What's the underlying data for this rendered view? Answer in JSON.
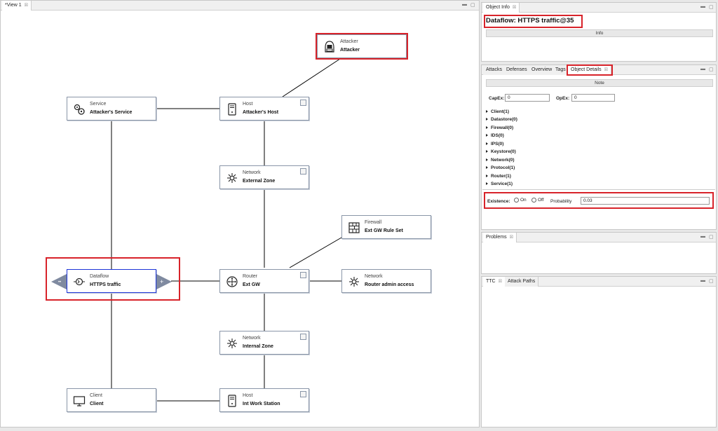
{
  "editor": {
    "tab_label": "*View 1",
    "close_glyph": "☒",
    "min_glyph": "▬",
    "max_glyph": "▢"
  },
  "nodes": {
    "attacker": {
      "type": "Attacker",
      "name": "Attacker",
      "icon": "hacker-icon"
    },
    "service": {
      "type": "Service",
      "name": "Attacker's Service",
      "icon": "gears-icon"
    },
    "host_attacker": {
      "type": "Host",
      "name": "Attacker's Host",
      "icon": "server-icon"
    },
    "external_zone": {
      "type": "Network",
      "name": "External Zone",
      "icon": "network-icon"
    },
    "firewall": {
      "type": "Firewall",
      "name": "Ext GW Rule Set",
      "icon": "firewall-icon"
    },
    "dataflow": {
      "type": "Dataflow",
      "name": "HTTPS traffic",
      "icon": "dataflow-icon"
    },
    "router": {
      "type": "Router",
      "name": "Ext GW",
      "icon": "router-icon"
    },
    "router_network": {
      "type": "Network",
      "name": "Router admin access",
      "icon": "network-icon"
    },
    "internal_zone": {
      "type": "Network",
      "name": "Internal Zone",
      "icon": "network-icon"
    },
    "client": {
      "type": "Client",
      "name": "Client",
      "icon": "monitor-icon"
    },
    "host_ws": {
      "type": "Host",
      "name": "Int Work Station",
      "icon": "server-icon"
    }
  },
  "object_info": {
    "tab_label": "Object Info",
    "title": "Dataflow: HTTPS traffic@35",
    "info_button": "Info"
  },
  "details": {
    "tabs": [
      "Attacks",
      "Defenses",
      "Overview",
      "Tags",
      "Object Details"
    ],
    "note_button": "Note",
    "capex_label": "CapEx:",
    "capex_value": "0",
    "opex_label": "OpEx:",
    "opex_value": "0",
    "tree": [
      "Client(1)",
      "Datastore(0)",
      "Firewall(0)",
      "IDS(0)",
      "IPS(0)",
      "Keystore(0)",
      "Network(0)",
      "Protocol(1)",
      "Router(1)",
      "Service(1)"
    ],
    "existence_label": "Existence:",
    "on_label": "On",
    "off_label": "Off",
    "probability_label": "Probability",
    "probability_value": "0.03"
  },
  "problems": {
    "tab_label": "Problems"
  },
  "bottom": {
    "tabs": [
      "TTC",
      "Attack Paths"
    ]
  },
  "colors": {
    "selection_red": "#d8232a",
    "selection_blue": "#1c34d8",
    "node_border": "#8a96a8",
    "arrow_fill": "#7f8aa0"
  }
}
